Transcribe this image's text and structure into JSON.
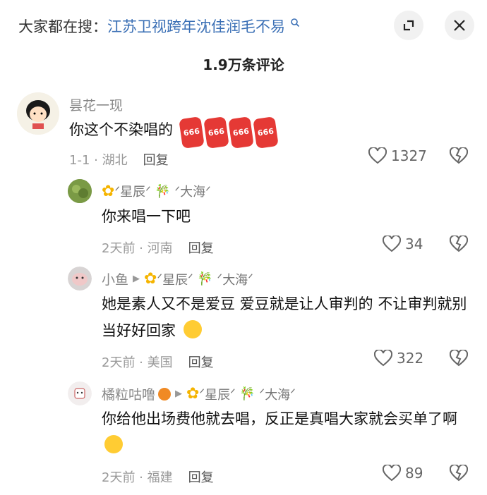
{
  "search": {
    "prefix": "大家都在搜：",
    "link": "江苏卫视跨年沈佳润毛不易"
  },
  "comment_count": "1.9万条评论",
  "comments": [
    {
      "user": "昙花一现",
      "text": "你这个不染唱的",
      "emoji": "666",
      "meta": "1-1 · 湖北",
      "reply_label": "回复",
      "likes": "1327"
    },
    {
      "user_badge": "星辰",
      "user_badge2": "大海",
      "text": "你来唱一下吧",
      "meta": "2天前 · 河南",
      "reply_label": "回复",
      "likes": "34"
    },
    {
      "user": "小鱼",
      "user_badge": "星辰",
      "user_badge2": "大海",
      "text": "她是素人又不是爱豆 爱豆就是让人审判的 不让审判就别当好好回家",
      "meta": "2天前 · 美国",
      "reply_label": "回复",
      "likes": "322"
    },
    {
      "user": "橘粒咕噜",
      "user_badge": "星辰",
      "user_badge2": "大海",
      "text": "你给他出场费他就去唱，反正是真唱大家就会买单了啊",
      "meta": "2天前 · 福建",
      "reply_label": "回复",
      "likes": "89"
    }
  ]
}
